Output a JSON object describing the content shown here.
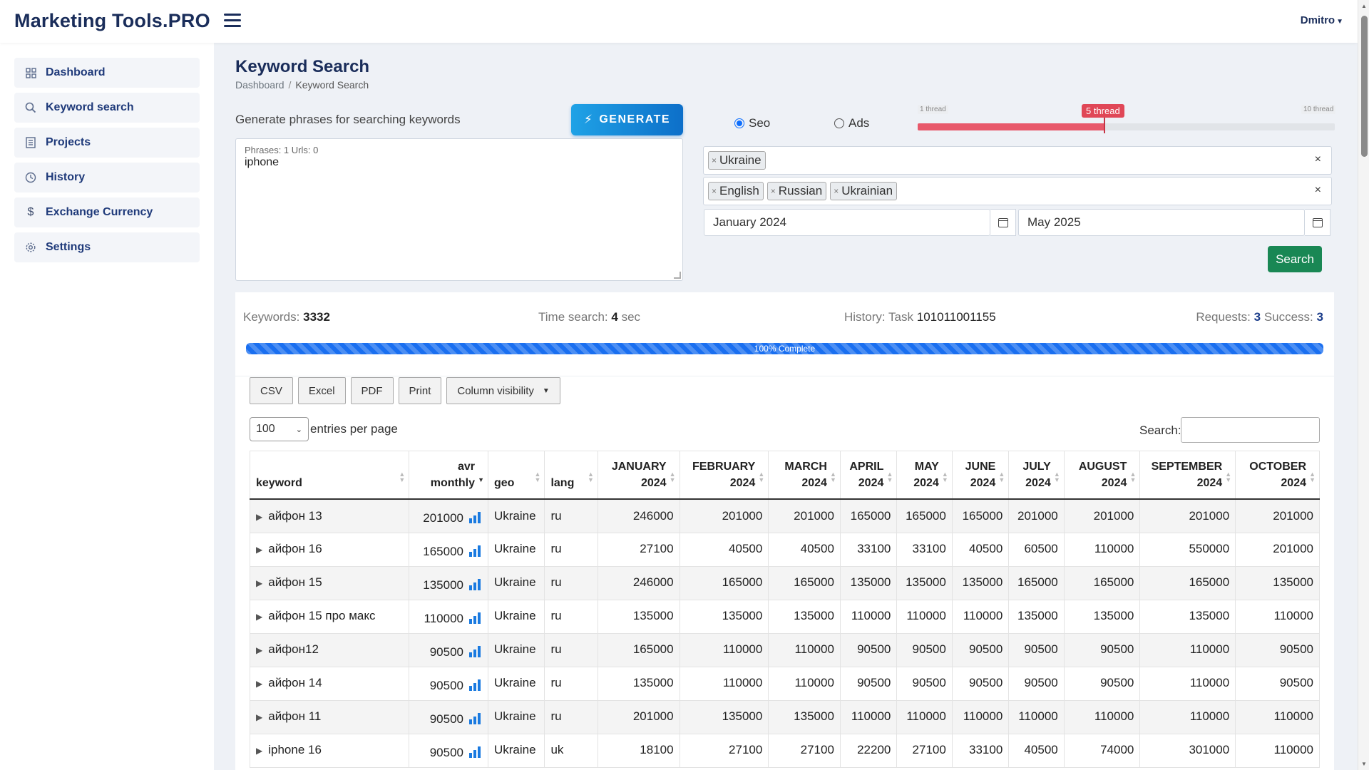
{
  "app": {
    "brand": "Marketing Tools.PRO",
    "user": "Dmitro"
  },
  "sidebar": {
    "items": [
      {
        "label": "Dashboard",
        "icon": "grid-icon"
      },
      {
        "label": "Keyword search",
        "icon": "search-icon"
      },
      {
        "label": "Projects",
        "icon": "projects-icon"
      },
      {
        "label": "History",
        "icon": "clock-icon"
      },
      {
        "label": "Exchange Currency",
        "icon": "dollar-icon"
      },
      {
        "label": "Settings",
        "icon": "gear-icon"
      }
    ]
  },
  "page": {
    "title": "Keyword Search",
    "breadcrumb": {
      "home": "Dashboard",
      "separator": "/",
      "current": "Keyword Search"
    }
  },
  "generator": {
    "label": "Generate phrases for searching keywords",
    "button": "GENERATE",
    "stats": "Phrases: 1 Urls: 0",
    "text": "iphone"
  },
  "mode": {
    "seo": "Seo",
    "ads": "Ads",
    "selected": "Seo"
  },
  "threads": {
    "min": "1 thread",
    "max": "10 thread",
    "current": "5 thread",
    "fraction": 0.45
  },
  "filters": {
    "countries": [
      "Ukraine"
    ],
    "languages": [
      "English",
      "Russian",
      "Ukrainian"
    ],
    "clear": "×",
    "date_from": "January 2024",
    "date_to": "May 2025",
    "search_button": "Search"
  },
  "results": {
    "keywords_label": "Keywords:",
    "keywords": "3332",
    "time_label": "Time search:",
    "time": "4",
    "time_unit": "sec",
    "history_label": "History: Task",
    "task": "101011001155",
    "requests_label": "Requests:",
    "requests": "3",
    "success_label": "Success:",
    "success": "3",
    "progress_text": "100% Complete",
    "progress_percent": 100
  },
  "toolbar": {
    "csv": "CSV",
    "excel": "Excel",
    "pdf": "PDF",
    "print": "Print",
    "colvis": "Column visibility"
  },
  "table": {
    "entries_value": "100",
    "entries_label": "entries per page",
    "search_label": "Search:",
    "headers": [
      "keyword",
      "avr monthly",
      "geo",
      "lang",
      "JANUARY 2024",
      "FEBRUARY 2024",
      "MARCH 2024",
      "APRIL 2024",
      "MAY 2024",
      "JUNE 2024",
      "JULY 2024",
      "AUGUST 2024",
      "SEPTEMBER 2024",
      "OCTOBER 2024"
    ],
    "rows": [
      [
        "айфон 13",
        "201000",
        "Ukraine",
        "ru",
        "246000",
        "201000",
        "201000",
        "165000",
        "165000",
        "165000",
        "201000",
        "201000",
        "201000",
        "201000"
      ],
      [
        "айфон 16",
        "165000",
        "Ukraine",
        "ru",
        "27100",
        "40500",
        "40500",
        "33100",
        "33100",
        "40500",
        "60500",
        "110000",
        "550000",
        "201000"
      ],
      [
        "айфон 15",
        "135000",
        "Ukraine",
        "ru",
        "246000",
        "165000",
        "165000",
        "135000",
        "135000",
        "135000",
        "165000",
        "165000",
        "165000",
        "135000"
      ],
      [
        "айфон 15 про макс",
        "110000",
        "Ukraine",
        "ru",
        "135000",
        "135000",
        "135000",
        "110000",
        "110000",
        "110000",
        "135000",
        "135000",
        "135000",
        "110000"
      ],
      [
        "айфон12",
        "90500",
        "Ukraine",
        "ru",
        "165000",
        "110000",
        "110000",
        "90500",
        "90500",
        "90500",
        "90500",
        "90500",
        "110000",
        "90500"
      ],
      [
        "айфон 14",
        "90500",
        "Ukraine",
        "ru",
        "135000",
        "110000",
        "110000",
        "90500",
        "90500",
        "90500",
        "90500",
        "90500",
        "110000",
        "90500"
      ],
      [
        "айфон 11",
        "90500",
        "Ukraine",
        "ru",
        "201000",
        "135000",
        "135000",
        "110000",
        "110000",
        "110000",
        "110000",
        "110000",
        "110000",
        "110000"
      ],
      [
        "iphone 16",
        "90500",
        "Ukraine",
        "uk",
        "18100",
        "27100",
        "27100",
        "22200",
        "27100",
        "33100",
        "40500",
        "74000",
        "301000",
        "110000"
      ]
    ]
  },
  "colors": {
    "brand": "#1a2d5a",
    "accent": "#0d6efd",
    "success": "#198754",
    "danger": "#e04757",
    "progress": "#1a6ff0"
  }
}
